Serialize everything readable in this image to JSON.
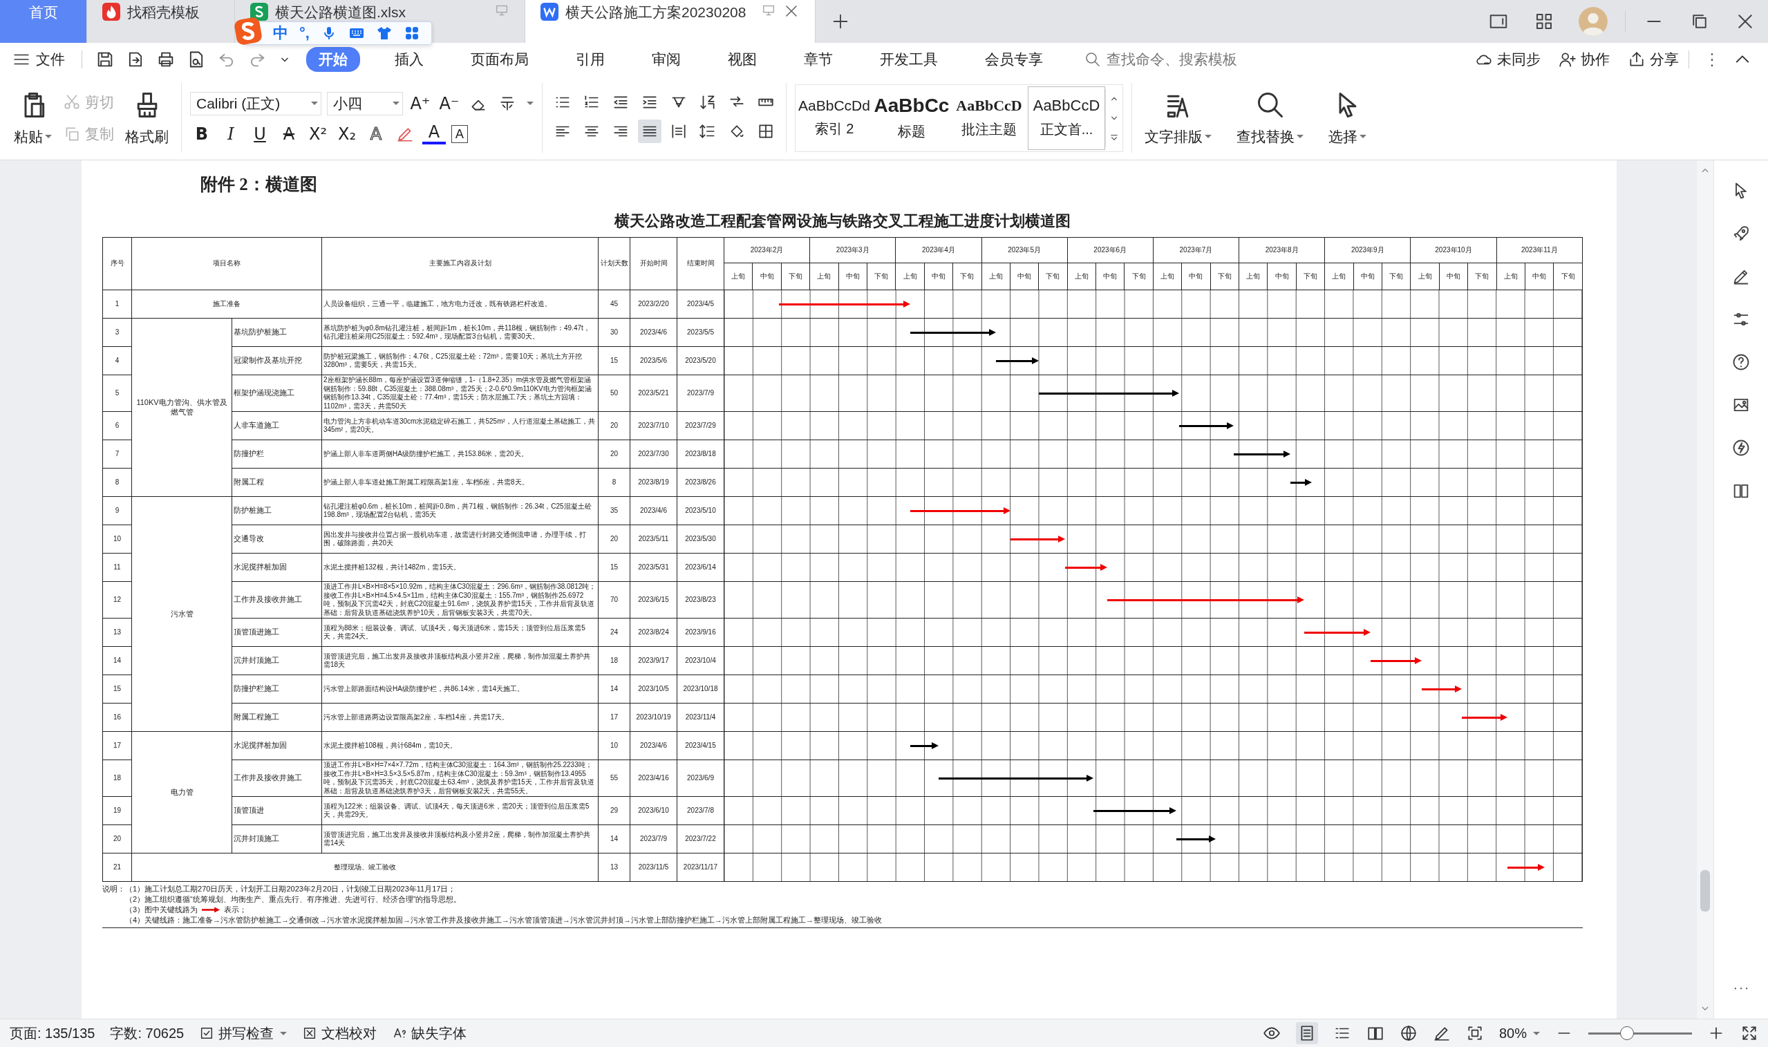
{
  "window_tabs": [
    {
      "label": "首页",
      "kind": "home",
      "selected": false
    },
    {
      "label": "找稻壳模板",
      "kind": "template",
      "selected": false
    },
    {
      "label": "横天公路横道图.xlsx",
      "kind": "sheet",
      "selected": false
    },
    {
      "label": "横天公路施工方案20230208",
      "kind": "writer",
      "selected": true
    }
  ],
  "ime_toolbar": {
    "mode": "中",
    "punctuation": "°,"
  },
  "menu": {
    "file": "文件",
    "tabs": [
      {
        "label": "开始",
        "selected": true
      },
      {
        "label": "插入",
        "selected": false
      },
      {
        "label": "页面布局",
        "selected": false
      },
      {
        "label": "引用",
        "selected": false
      },
      {
        "label": "审阅",
        "selected": false
      },
      {
        "label": "视图",
        "selected": false
      },
      {
        "label": "章节",
        "selected": false
      },
      {
        "label": "开发工具",
        "selected": false
      },
      {
        "label": "会员专享",
        "selected": false
      }
    ],
    "search": {
      "placeholder": "查找命令、搜索模板"
    },
    "actions": [
      {
        "label": "未同步",
        "kind": "sync"
      },
      {
        "label": "协作",
        "kind": "collab"
      },
      {
        "label": "分享",
        "kind": "share"
      }
    ]
  },
  "ribbon": {
    "clipboard": [
      {
        "label": "粘贴",
        "kind": "paste",
        "disabled": false
      },
      {
        "label": "剪切",
        "kind": "cut",
        "disabled": true
      },
      {
        "label": "复制",
        "kind": "copy",
        "disabled": true
      },
      {
        "label": "格式刷",
        "kind": "painter",
        "disabled": false
      }
    ],
    "font": {
      "name": "Calibri (正文)",
      "size": "小四"
    },
    "size_buttons": [
      "A⁺",
      "A⁻"
    ],
    "format_buttons": [
      {
        "label": "B",
        "kind": "bold"
      },
      {
        "label": "I",
        "kind": "italic"
      },
      {
        "label": "U",
        "kind": "underline"
      },
      {
        "label": "A",
        "kind": "strike"
      },
      {
        "label": "X²",
        "kind": "plain"
      },
      {
        "label": "X₂",
        "kind": "plain"
      },
      {
        "label": "A",
        "kind": "outline"
      },
      {
        "label": "A",
        "kind": "color"
      },
      {
        "label": "A",
        "kind": "boxed"
      }
    ],
    "alignment": [
      {
        "selected": false
      },
      {
        "selected": false
      },
      {
        "selected": false
      },
      {
        "selected": true
      },
      {
        "selected": false
      }
    ],
    "styles": [
      {
        "preview": "AaBbCcDd",
        "label": "索引 2",
        "kind": "index",
        "selected": false
      },
      {
        "preview": "AaBbCc",
        "label": "标题",
        "kind": "heading",
        "selected": false
      },
      {
        "preview": "AaBbCcD",
        "label": "批注主题",
        "kind": "comment",
        "selected": false
      },
      {
        "preview": "AaBbCcD",
        "label": "正文首...",
        "kind": "body",
        "selected": true
      }
    ],
    "tools": [
      {
        "label": "文字排版",
        "kind": "layout"
      },
      {
        "label": "查找替换",
        "kind": "find"
      },
      {
        "label": "选择",
        "kind": "select"
      }
    ]
  },
  "document": {
    "heading": "附件 2：横道图",
    "schedule": {
      "title": "横天公路改造工程配套管网设施与铁路交叉工程施工进度计划横道图",
      "headers": {
        "no": "序号",
        "name": "项目名称",
        "content": "主要施工内容及计划",
        "days": "计划天数",
        "start": "开始时间",
        "end": "结束时间"
      },
      "months": [
        {
          "label": "2023年2月",
          "dekads": [
            "上旬",
            "中旬",
            "下旬"
          ]
        },
        {
          "label": "2023年3月",
          "dekads": [
            "上旬",
            "中旬",
            "下旬"
          ]
        },
        {
          "label": "2023年4月",
          "dekads": [
            "上旬",
            "中旬",
            "下旬"
          ]
        },
        {
          "label": "2023年5月",
          "dekads": [
            "上旬",
            "中旬",
            "下旬"
          ]
        },
        {
          "label": "2023年6月",
          "dekads": [
            "上旬",
            "中旬",
            "下旬"
          ]
        },
        {
          "label": "2023年7月",
          "dekads": [
            "上旬",
            "中旬",
            "下旬"
          ]
        },
        {
          "label": "2023年8月",
          "dekads": [
            "上旬",
            "中旬",
            "下旬"
          ]
        },
        {
          "label": "2023年9月",
          "dekads": [
            "上旬",
            "中旬",
            "下旬"
          ]
        },
        {
          "label": "2023年10月",
          "dekads": [
            "上旬",
            "中旬",
            "下旬"
          ]
        },
        {
          "label": "2023年11月",
          "dekads": [
            "上旬",
            "中旬",
            "下旬"
          ]
        }
      ],
      "sections": [
        {
          "kind": "single",
          "row": {
            "no": "1",
            "name": "施工准备",
            "content": "人员设备组织，三通一平，临建施工，地方电力迁改，既有铁路栏杆改造。",
            "days": "45",
            "start": "2023/2/20",
            "end": "2023/4/5",
            "critical": true
          }
        },
        {
          "kind": "group",
          "name": "110KV电力管沟、供水管及燃气管",
          "rows": [
            {
              "no": "3",
              "name": "基坑防护桩施工",
              "content": "基坑防护桩为φ0.8m钻孔灌注桩，桩间距1m，桩长10m，共118根，钢筋制作：49.47t，钻孔灌注桩采用C25混凝土：592.4m³，现场配置3台钻机，需要30天。",
              "days": "30",
              "start": "2023/4/6",
              "end": "2023/5/5",
              "critical": false
            },
            {
              "no": "4",
              "name": "冠梁制作及基坑开挖",
              "content": "防护桩冠梁施工，钢筋制作：4.76t，C25混凝土砼：72m³，需要10天；基坑土方开挖3280m³，需要5天，共需15天。",
              "days": "15",
              "start": "2023/5/6",
              "end": "2023/5/20",
              "critical": false
            },
            {
              "no": "5",
              "name": "框架护涵现浇施工",
              "content": "2座框架护涵长88m，每座护涵设置3道伸缩缝，1-（1.8+2.35）m供水管及燃气管框架涵钢筋制作：59.88t，C35混凝土：388.08m³，需25天；2-0.6*0.9m110KV电力管沟框架涵钢筋制作13.34t，C35混凝土砼：77.4m³，需15天；防水层施工7天；基坑土方回填：1102m³，需3天，共需50天",
              "days": "50",
              "start": "2023/5/21",
              "end": "2023/7/9",
              "critical": false
            },
            {
              "no": "6",
              "name": "人非车道施工",
              "content": "电力管沟上方非机动车道30cm水泥稳定碎石施工，共525m²，人行道混凝土基础施工，共345m²，需20天。",
              "days": "20",
              "start": "2023/7/10",
              "end": "2023/7/29",
              "critical": false
            },
            {
              "no": "7",
              "name": "防撞护栏",
              "content": "护涵上部人非车道两侧HA级防撞护栏施工，共153.86米，需20天。",
              "days": "20",
              "start": "2023/7/30",
              "end": "2023/8/18",
              "critical": false
            },
            {
              "no": "8",
              "name": "附属工程",
              "content": "护涵上部人非车道处施工附属工程限高架1座，车档6座，共需8天。",
              "days": "8",
              "start": "2023/8/19",
              "end": "2023/8/26",
              "critical": false
            }
          ]
        },
        {
          "kind": "group",
          "name": "污水管",
          "rows": [
            {
              "no": "9",
              "name": "防护桩施工",
              "content": "钻孔灌注桩φ0.6m，桩长10m，桩间距0.8m，共71根，钢筋制作：26.34t，C25混凝土砼198.8m³，现场配置2台钻机，需35天",
              "days": "35",
              "start": "2023/4/6",
              "end": "2023/5/10",
              "critical": true
            },
            {
              "no": "10",
              "name": "交通导改",
              "content": "因出发井与接收井位置占据一股机动车道，故需进行封路交通倒流申请，办理手续，打围，破除路面，共20天",
              "days": "20",
              "start": "2023/5/11",
              "end": "2023/5/30",
              "critical": true
            },
            {
              "no": "11",
              "name": "水泥搅拌桩加固",
              "content": "水泥土搅拌桩132根，共计1482m，需15天。",
              "days": "15",
              "start": "2023/5/31",
              "end": "2023/6/14",
              "critical": true
            },
            {
              "no": "12",
              "name": "工作井及接收井施工",
              "content": "顶进工作井L×B×H=8×5×10.92m，结构主体C30混凝土：296.6m³，钢筋制作38.0812吨；接收工作井L×B×H=4.5×4.5×11m，结构主体C30混凝土：155.7m³，钢筋制作25.6972吨，预制及下沉需42天，封底C20混凝土91.6m³，浇筑及养护需15天，工作井后背及轨道基础：后背及轨道基础浇筑养护10天，后背钢板安装3天，共需70天。",
              "days": "70",
              "start": "2023/6/15",
              "end": "2023/8/23",
              "critical": true
            },
            {
              "no": "13",
              "name": "顶管顶进施工",
              "content": "顶程为88米；组装设备、调试、试顶4天，每天顶进6米，需15天；顶管到位后压浆需5天，共需24天。",
              "days": "24",
              "start": "2023/8/24",
              "end": "2023/9/16",
              "critical": true
            },
            {
              "no": "14",
              "name": "沉井封顶施工",
              "content": "顶管顶进完后，施工出发井及接收井顶板结构及小竖井2座，爬梯，制作加混凝土养护共需18天",
              "days": "18",
              "start": "2023/9/17",
              "end": "2023/10/4",
              "critical": true
            },
            {
              "no": "15",
              "name": "防撞护栏施工",
              "content": "污水管上部路面结构设HA级防撞护栏，共86.14米，需14天施工。",
              "days": "14",
              "start": "2023/10/5",
              "end": "2023/10/18",
              "critical": true
            },
            {
              "no": "16",
              "name": "附属工程施工",
              "content": "污水管上部道路两边设置限高架2座，车档14座，共需17天。",
              "days": "17",
              "start": "2023/10/19",
              "end": "2023/11/4",
              "critical": true
            }
          ]
        },
        {
          "kind": "group",
          "name": "电力管",
          "rows": [
            {
              "no": "17",
              "name": "水泥搅拌桩加固",
              "content": "水泥土搅拌桩108根，共计684m，需10天。",
              "days": "10",
              "start": "2023/4/6",
              "end": "2023/4/15",
              "critical": false
            },
            {
              "no": "18",
              "name": "工作井及接收井施工",
              "content": "顶进工作井L×B×H=7×4×7.72m，结构主体C30混凝土：164.3m³，钢筋制作25.2233吨；接收工作井L×B×H=3.5×3.5×5.87m，结构主体C30混凝土：59.3m³，钢筋制作13.4955吨，预制及下沉需35天，封底C20混凝土63.4m³，浇筑及养护需15天，工作井后背及轨道基础：后背及轨道基础浇筑养护3天，后背钢板安装2天，共需55天。",
              "days": "55",
              "start": "2023/4/16",
              "end": "2023/6/9",
              "critical": false
            },
            {
              "no": "19",
              "name": "顶管顶进",
              "content": "顶程为122米；组装设备、调试、试顶4天，每天顶进6米，需20天；顶管到位后压浆需5天，共需29天。",
              "days": "29",
              "start": "2023/6/10",
              "end": "2023/7/8",
              "critical": false
            },
            {
              "no": "20",
              "name": "沉井封顶施工",
              "content": "顶管顶进完后，施工出发井及接收井顶板结构及小竖井2座，爬梯，制作加混凝土养护共需14天",
              "days": "14",
              "start": "2023/7/9",
              "end": "2023/7/22",
              "critical": false
            }
          ]
        },
        {
          "kind": "closing",
          "row": {
            "no": "21",
            "name": "整理现场、竣工验收",
            "days": "13",
            "start": "2023/11/5",
            "end": "2023/11/17",
            "critical": true
          }
        }
      ]
    },
    "notes": {
      "label": "说明：",
      "lines": [
        {
          "kind": "text",
          "text": "（1）施工计划总工期270日历天，计划开工日期2023年2月20日，计划竣工日期2023年11月17日；"
        },
        {
          "kind": "text",
          "text": "（2）施工组织遵循“统筹规划、均衡生产、重点先行、有序推进、先进可行、经济合理”的指导思想。"
        },
        {
          "kind": "legend",
          "before": "（3）图中关键线路为",
          "after": "表示；"
        },
        {
          "kind": "text",
          "text": "（4）关键线路：施工准备→污水管防护桩施工→交通倒改→污水管水泥搅拌桩加固→污水管工作井及接收井施工→污水管顶管顶进→污水管沉井封顶→污水管上部防撞护栏施工→污水管上部附属工程施工→整理现场、竣工验收"
        }
      ]
    }
  },
  "status_bar": {
    "page": "页面: 135/135",
    "words": "字数: 70625",
    "spell": "拼写检查",
    "proof": "文档校对",
    "fonts": "缺失字体",
    "zoom": "80%",
    "zoom_slider": {
      "level": 0.37
    }
  }
}
